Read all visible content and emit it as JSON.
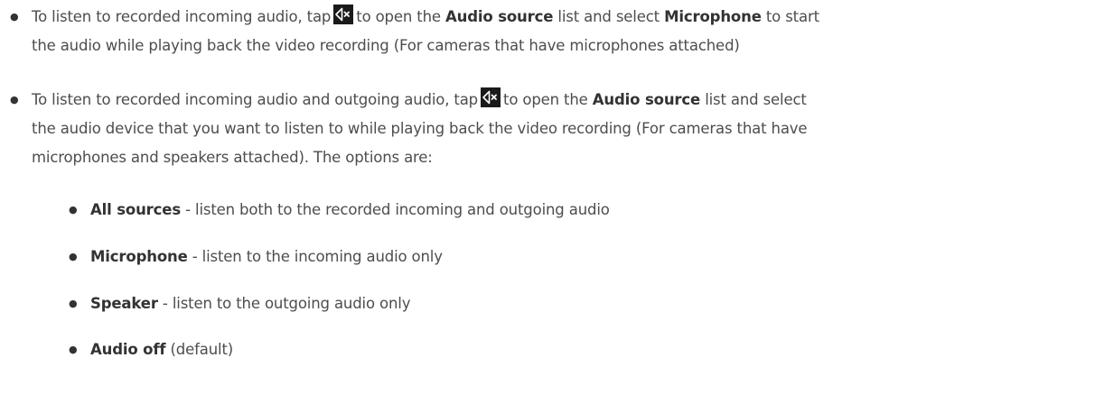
{
  "items": [
    {
      "lines": [
        {
          "pre": "To listen to recorded incoming audio, tap",
          "icon": "speaker-muted-icon",
          "post": "to open the",
          "bold1": "Audio source",
          "mid": "list and select",
          "bold2": "Microphone",
          "end": "to start"
        },
        {
          "text": "the audio while playing back the video recording (For cameras that have microphones attached)"
        }
      ]
    },
    {
      "lines": [
        {
          "pre": "To listen to recorded incoming audio and outgoing audio, tap",
          "icon": "speaker-muted-icon",
          "post": "to open the",
          "bold1": "Audio source",
          "mid": "list and select"
        },
        {
          "text": "the audio device that you want to listen to while playing back the video recording (For cameras that have"
        },
        {
          "text": "microphones and speakers attached). The options are:"
        }
      ]
    }
  ],
  "options": [
    {
      "term": "All sources",
      "desc": " - listen both to the recorded incoming and outgoing audio"
    },
    {
      "term": "Microphone",
      "desc": " - listen to the incoming audio only"
    },
    {
      "term": "Speaker",
      "desc": " - listen to the outgoing audio only"
    },
    {
      "term": "Audio off",
      "desc": " (default)"
    }
  ],
  "icon_colors": {
    "background": "#1a1a1a",
    "foreground": "#ffffff"
  }
}
